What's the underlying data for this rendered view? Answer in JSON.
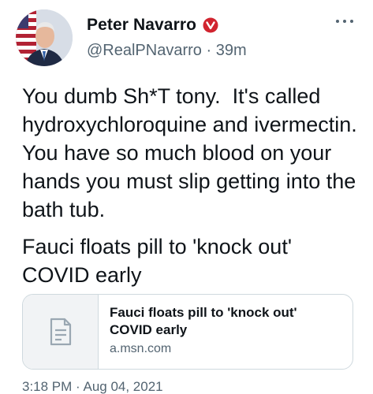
{
  "tweet": {
    "author": {
      "name": "Peter Navarro",
      "handle": "@RealPNavarro",
      "separator": "·",
      "time_ago": "39m"
    },
    "text": "You dumb Sh*T tony.  It's called hydroxychloroquine and ivermectin.  You have so much blood on your hands you must slip getting into the bath tub.",
    "link_text": "Fauci floats pill to 'knock out' COVID early",
    "card": {
      "title": "Fauci floats pill to 'knock out' COVID early",
      "domain": "a.msn.com"
    },
    "timestamp": "3:18 PM · Aug 04, 2021"
  },
  "icons": {
    "verified": "verified-badge-icon",
    "more": "more-options-icon",
    "card_placeholder": "article-placeholder-icon"
  },
  "colors": {
    "verified_badge": "#d1242f",
    "secondary_text": "#536471",
    "card_border": "#cfd9de"
  }
}
